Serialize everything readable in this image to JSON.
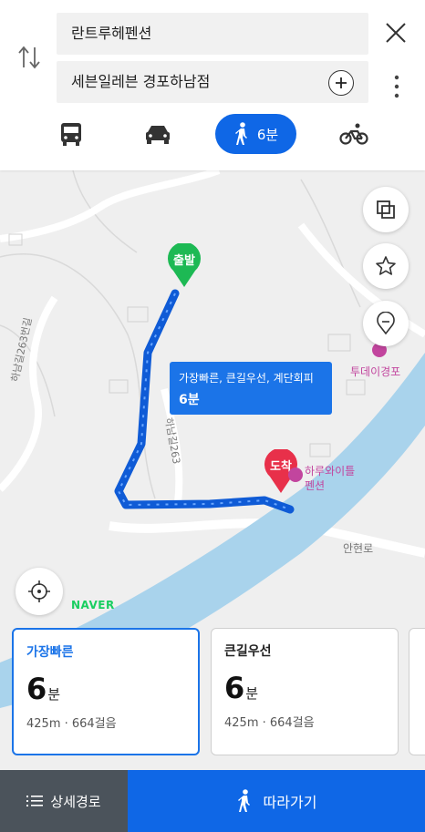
{
  "search": {
    "origin": "란트루헤펜션",
    "destination": "세븐일레븐 경포하남점"
  },
  "modes": {
    "walk_time": "6분",
    "active": "walk"
  },
  "map": {
    "start_label": "출발",
    "end_label": "도착",
    "route_tip_line1": "가장빠른, 큰길우선, 계단회피",
    "route_tip_line2": "6분",
    "poi_1": "투데이경포",
    "poi_2_line1": "하루와이틀",
    "poi_2_line2": "펜션",
    "road_1": "하남길263",
    "road_2": "하남길263번길",
    "road_3": "안현로",
    "brand": "NAVER"
  },
  "routes": [
    {
      "name": "가장빠른",
      "time_num": "6",
      "time_unit": "분",
      "dist": "425m · 664걸음"
    },
    {
      "name": "큰길우선",
      "time_num": "6",
      "time_unit": "분",
      "dist": "425m · 664걸음"
    }
  ],
  "bottom": {
    "detail_label": "상세경로",
    "follow_label": "따라가기"
  },
  "colors": {
    "accent": "#0f67e6",
    "start_marker": "#1db954",
    "end_marker": "#e8304a",
    "river": "#a9d3ec"
  }
}
